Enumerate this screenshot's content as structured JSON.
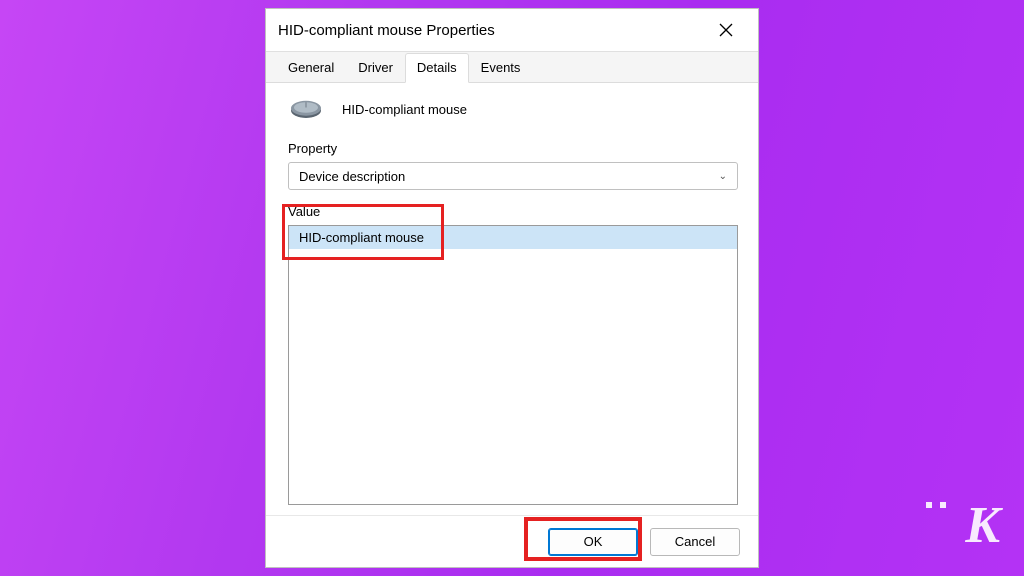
{
  "dialog": {
    "title": "HID-compliant mouse Properties",
    "device_name": "HID-compliant mouse"
  },
  "tabs": {
    "general": "General",
    "driver": "Driver",
    "details": "Details",
    "events": "Events"
  },
  "labels": {
    "property": "Property",
    "value": "Value"
  },
  "dropdown": {
    "selected": "Device description"
  },
  "value_list": {
    "item0": "HID-compliant mouse"
  },
  "buttons": {
    "ok": "OK",
    "cancel": "Cancel"
  },
  "watermark": {
    "letter": "K"
  }
}
